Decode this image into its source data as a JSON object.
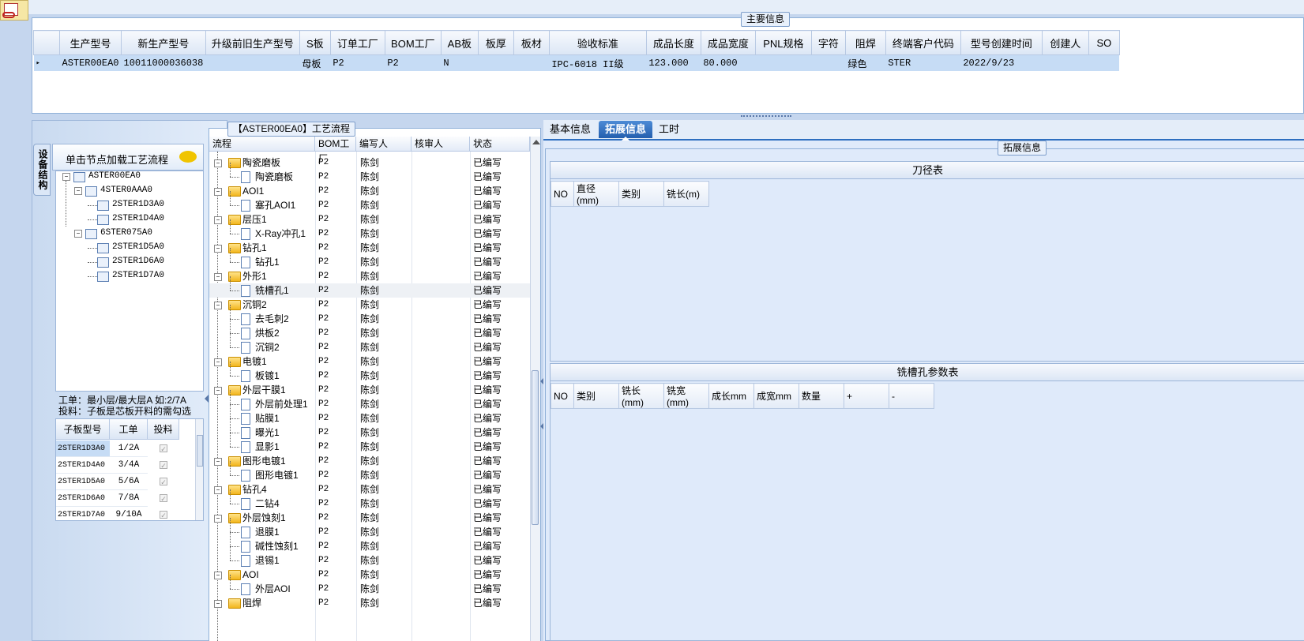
{
  "main_info": {
    "title": "主要信息",
    "columns": [
      "生产型号",
      "新生产型号",
      "升级前旧生产型号",
      "S板",
      "订单工厂",
      "BOM工厂",
      "AB板",
      "板厚",
      "板材",
      "验收标准",
      "成品长度",
      "成品宽度",
      "PNL规格",
      "字符",
      "阻焊",
      "终端客户代码",
      "型号创建时间",
      "创建人",
      "SO"
    ],
    "row": [
      "ASTER00EA0",
      "10011000036038",
      "",
      "母板",
      "P2",
      "P2",
      "N",
      "",
      "",
      "IPC-6018 II级",
      "123.000",
      "80.000",
      "",
      "",
      "绿色",
      "STER",
      "2022/9/23",
      "",
      ""
    ]
  },
  "left_panel": {
    "vertical_tab": "设备结构",
    "hint": "单击节点加载工艺流程",
    "tree": {
      "root": "ASTER00EA0",
      "children": [
        {
          "label": "4STER0AAA0",
          "children": [
            "2STER1D3A0",
            "2STER1D4A0"
          ]
        },
        {
          "label": "6STER075A0",
          "children": [
            "2STER1D5A0",
            "2STER1D6A0",
            "2STER1D7A0"
          ]
        }
      ]
    },
    "note1": "工单：最小层/最大层A 如:2/7A",
    "note2": "投料：子板是芯板开料的需勾选",
    "sub_table": {
      "headers": [
        "子板型号",
        "工单",
        "投料"
      ],
      "rows": [
        [
          "2STER1D3A0",
          "1/2A"
        ],
        [
          "2STER1D4A0",
          "3/4A"
        ],
        [
          "2STER1D5A0",
          "5/6A"
        ],
        [
          "2STER1D6A0",
          "7/8A"
        ],
        [
          "2STER1D7A0",
          "9/10A"
        ]
      ]
    }
  },
  "flow": {
    "title": "【ASTER00EA0】工艺流程",
    "columns": [
      "流程",
      "BOM工厂",
      "编写人",
      "核审人",
      "状态"
    ],
    "factory": "P2",
    "writer": "陈剑",
    "status": "已编写",
    "rows": [
      {
        "label": "陶瓷磨板",
        "type": "folder"
      },
      {
        "label": "陶瓷磨板",
        "type": "doc"
      },
      {
        "label": "AOI1",
        "type": "folder"
      },
      {
        "label": "塞孔AOI1",
        "type": "doc"
      },
      {
        "label": "层压1",
        "type": "folder"
      },
      {
        "label": "X-Ray冲孔1",
        "type": "doc"
      },
      {
        "label": "钻孔1",
        "type": "folder"
      },
      {
        "label": "钻孔1",
        "type": "doc"
      },
      {
        "label": "外形1",
        "type": "folder"
      },
      {
        "label": "铣槽孔1",
        "type": "doc"
      },
      {
        "label": "沉铜2",
        "type": "folder"
      },
      {
        "label": "去毛刺2",
        "type": "doc"
      },
      {
        "label": "烘板2",
        "type": "doc"
      },
      {
        "label": "沉铜2",
        "type": "doc"
      },
      {
        "label": "电镀1",
        "type": "folder"
      },
      {
        "label": "板镀1",
        "type": "doc"
      },
      {
        "label": "外层干膜1",
        "type": "folder"
      },
      {
        "label": "外层前处理1",
        "type": "doc"
      },
      {
        "label": "贴膜1",
        "type": "doc"
      },
      {
        "label": "曝光1",
        "type": "doc"
      },
      {
        "label": "显影1",
        "type": "doc"
      },
      {
        "label": "图形电镀1",
        "type": "folder"
      },
      {
        "label": "图形电镀1",
        "type": "doc"
      },
      {
        "label": "钻孔4",
        "type": "folder"
      },
      {
        "label": "二钻4",
        "type": "doc"
      },
      {
        "label": "外层蚀刻1",
        "type": "folder"
      },
      {
        "label": "退膜1",
        "type": "doc"
      },
      {
        "label": "碱性蚀刻1",
        "type": "doc"
      },
      {
        "label": "退锡1",
        "type": "doc"
      },
      {
        "label": "AOI",
        "type": "folder"
      },
      {
        "label": "外层AOI",
        "type": "doc"
      },
      {
        "label": "阻焊",
        "type": "folder"
      }
    ]
  },
  "right_panel": {
    "tabs": [
      "基本信息",
      "拓展信息",
      "工时"
    ],
    "active_tab": "拓展信息",
    "group_title": "拓展信息",
    "tool_table": {
      "title": "刀径表",
      "columns": [
        "NO",
        "直径(mm)",
        "类别",
        "铣长(m)"
      ]
    },
    "slot_table": {
      "title": "铣槽孔参数表",
      "columns": [
        "NO",
        "类别",
        "铣长(mm)",
        "铣宽(mm)",
        "成长mm",
        "成宽mm",
        "数量",
        "+",
        "-"
      ]
    }
  },
  "colors": {
    "selected_row": "#c6dcf5",
    "panel_bg": "#dfeafa",
    "accent": "#2e6fc0"
  }
}
